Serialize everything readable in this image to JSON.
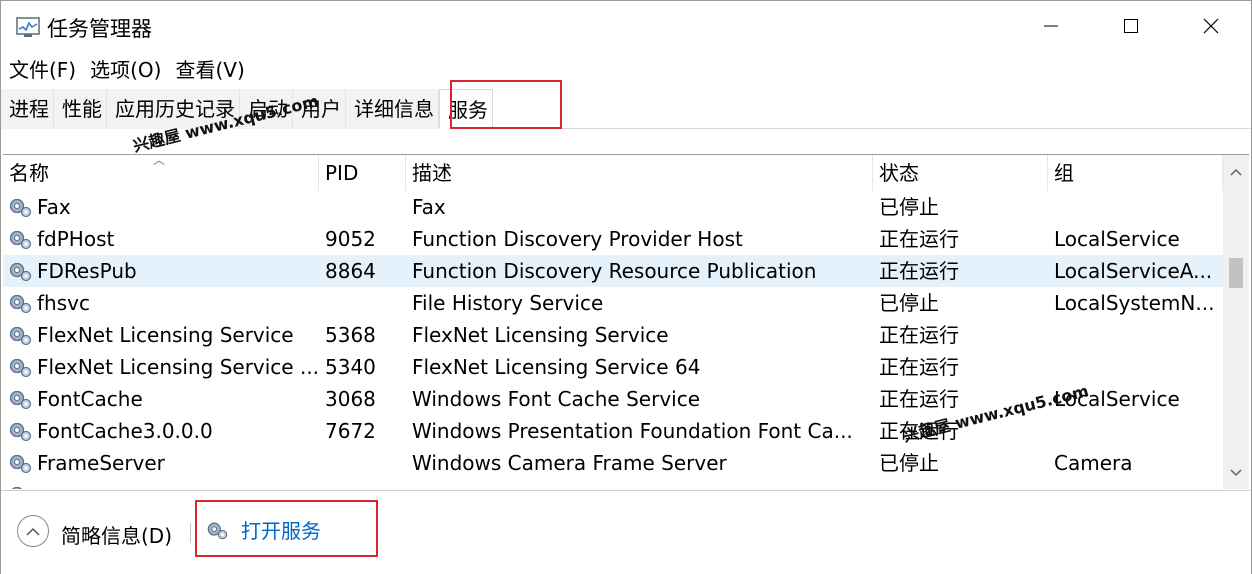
{
  "window": {
    "title": "任务管理器"
  },
  "menu": [
    "文件(F)",
    "选项(O)",
    "查看(V)"
  ],
  "tabs": [
    {
      "label": "进程"
    },
    {
      "label": "性能"
    },
    {
      "label": "应用历史记录"
    },
    {
      "label": "启动"
    },
    {
      "label": "用户"
    },
    {
      "label": "详细信息"
    },
    {
      "label": "服务",
      "active": true
    }
  ],
  "watermarks": [
    "兴趣屋 www.xqu5.com",
    "兴趣屋 www.xqu5.com"
  ],
  "table": {
    "columns": [
      "名称",
      "PID",
      "描述",
      "状态",
      "组"
    ],
    "rows": [
      {
        "name": "Fax",
        "pid": "",
        "desc": "Fax",
        "status": "已停止",
        "group": ""
      },
      {
        "name": "fdPHost",
        "pid": "9052",
        "desc": "Function Discovery Provider Host",
        "status": "正在运行",
        "group": "LocalService"
      },
      {
        "name": "FDResPub",
        "pid": "8864",
        "desc": "Function Discovery Resource Publication",
        "status": "正在运行",
        "group": "LocalServiceA...",
        "selected": true
      },
      {
        "name": "fhsvc",
        "pid": "",
        "desc": "File History Service",
        "status": "已停止",
        "group": "LocalSystemN..."
      },
      {
        "name": "FlexNet Licensing Service",
        "pid": "5368",
        "desc": "FlexNet Licensing Service",
        "status": "正在运行",
        "group": ""
      },
      {
        "name": "FlexNet Licensing Service ...",
        "pid": "5340",
        "desc": "FlexNet Licensing Service 64",
        "status": "正在运行",
        "group": ""
      },
      {
        "name": "FontCache",
        "pid": "3068",
        "desc": "Windows Font Cache Service",
        "status": "正在运行",
        "group": "LocalService"
      },
      {
        "name": "FontCache3.0.0.0",
        "pid": "7672",
        "desc": "Windows Presentation Foundation Font Ca...",
        "status": "正在运行",
        "group": ""
      },
      {
        "name": "FrameServer",
        "pid": "",
        "desc": "Windows Camera Frame Server",
        "status": "已停止",
        "group": "Camera"
      },
      {
        "name": "",
        "pid": "",
        "desc": "",
        "status": "",
        "group": ""
      }
    ]
  },
  "footer": {
    "brief_label": "简略信息(D)",
    "open_services_label": "打开服务"
  },
  "colors": {
    "highlight_box": "#d9252b",
    "selected_row": "#e5f1fb",
    "link": "#0066cc"
  }
}
